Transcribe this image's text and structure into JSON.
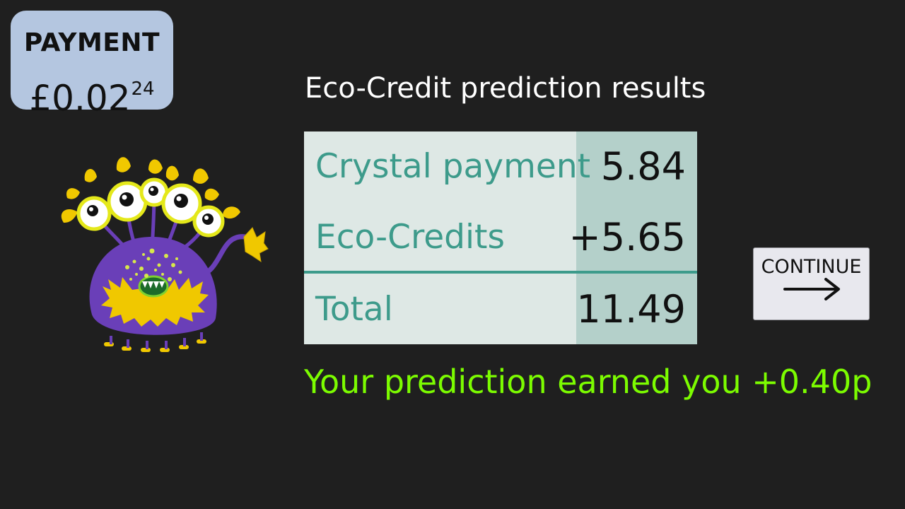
{
  "payment": {
    "label": "PAYMENT",
    "amount_main": "£0.02",
    "amount_fraction": "24"
  },
  "heading": "Eco-Credit prediction results",
  "results": {
    "rows": [
      {
        "label": "Crystal payment",
        "value": "5.84"
      },
      {
        "label": "Eco-Credits",
        "value": "+5.65"
      },
      {
        "label": "Total",
        "value": "11.49"
      }
    ]
  },
  "earned_message": "Your prediction earned you +0.40p",
  "continue_button": {
    "label": "CONTINUE",
    "icon": "arrow-right-icon"
  },
  "monster": {
    "icon": "purple-monster-illustration"
  },
  "colors": {
    "background": "#1f1f1f",
    "badge": "#b4c6e0",
    "table_light": "#dee8e5",
    "table_value_column": "#b4d0ca",
    "teal_text": "#3d9b8b",
    "earned_green": "#7cfc00",
    "monster_purple": "#6a3fb8",
    "monster_yellow": "#f0c800"
  }
}
